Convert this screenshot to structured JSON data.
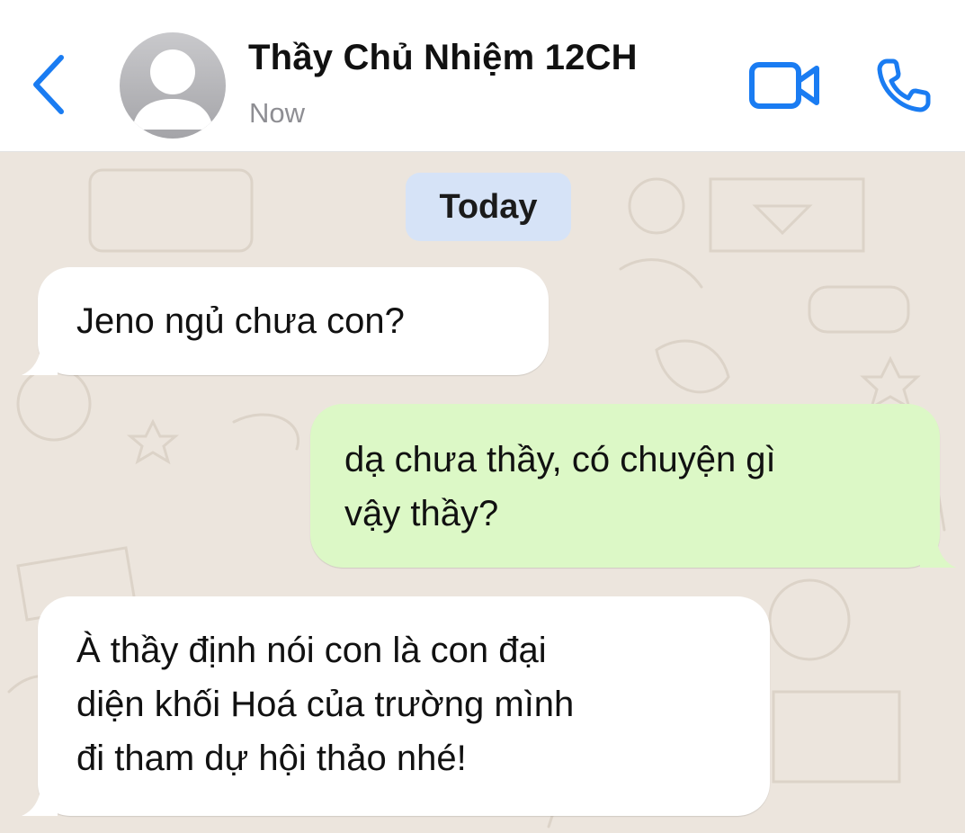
{
  "header": {
    "contact_name": "Thầy Chủ Nhiệm 12CH",
    "status": "Now",
    "icons": {
      "back": "chevron-left-icon",
      "avatar": "person-avatar-icon",
      "video": "video-camera-icon",
      "call": "phone-icon"
    },
    "accent_color": "#1a7cf2"
  },
  "chat": {
    "date_label": "Today",
    "messages": [
      {
        "direction": "incoming",
        "lines": [
          "Jeno ngủ chưa con?"
        ]
      },
      {
        "direction": "outgoing",
        "lines": [
          "dạ chưa thầy, có chuyện gì",
          "vậy thầy?"
        ]
      },
      {
        "direction": "incoming",
        "lines": [
          "À thầy định nói con là con đại",
          "diện khối Hoá của trường mình",
          "đi tham dự hội thảo nhé!"
        ]
      }
    ],
    "colors": {
      "incoming_bubble": "#ffffff",
      "outgoing_bubble": "#dcf8c6",
      "date_pill": "#d6e3f7",
      "wallpaper": "#ece5dd"
    }
  }
}
